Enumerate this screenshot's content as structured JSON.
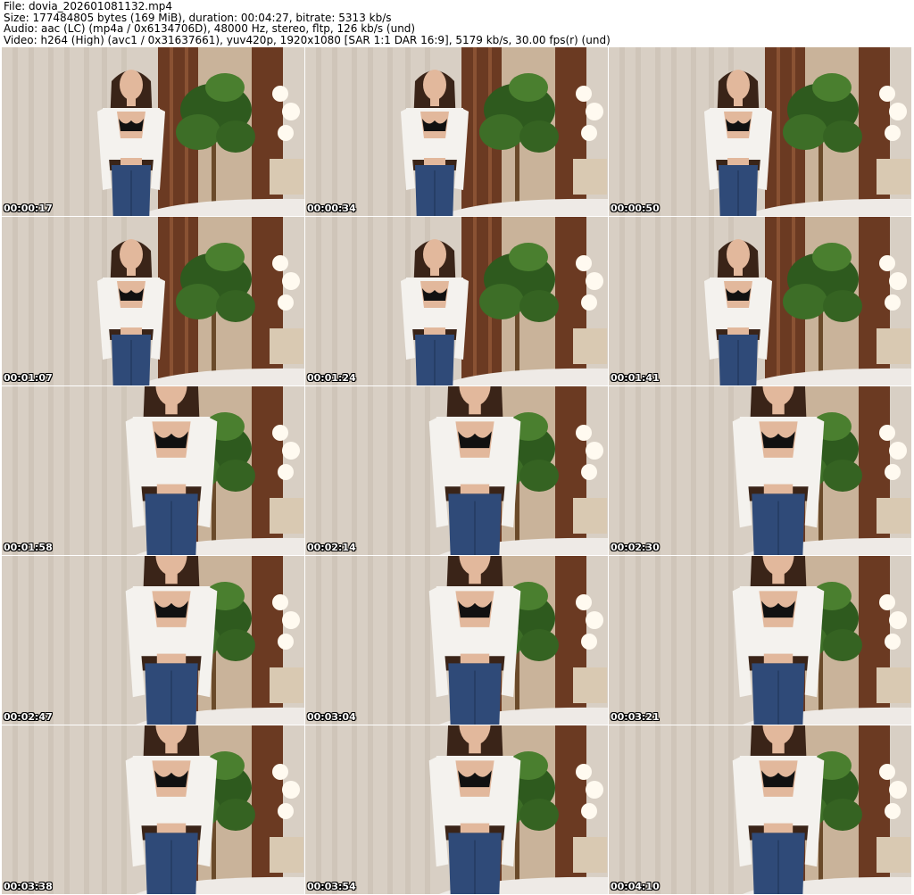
{
  "header": {
    "file_line": "File: dovia_202601081132.mp4",
    "size_line": "Size: 177484805 bytes (169 MiB), duration: 00:04:27, bitrate: 5313 kb/s",
    "audio_line": "Audio: aac (LC) (mp4a / 0x6134706D), 48000 Hz, stereo, fltp, 126 kb/s (und)",
    "video_line": "Video: h264 (High) (avc1 / 0x31637661), yuv420p, 1920x1080 [SAR 1:1 DAR 16:9], 5179 kb/s, 30.00 fps(r) (und)"
  },
  "thumbnails": [
    {
      "timestamp": "00:00:17",
      "zoom": 0,
      "offset": 0
    },
    {
      "timestamp": "00:00:34",
      "zoom": 0,
      "offset": 0
    },
    {
      "timestamp": "00:00:50",
      "zoom": 0,
      "offset": 0
    },
    {
      "timestamp": "00:01:07",
      "zoom": 0,
      "offset": 0
    },
    {
      "timestamp": "00:01:24",
      "zoom": 0,
      "offset": 0
    },
    {
      "timestamp": "00:01:41",
      "zoom": 0,
      "offset": 0
    },
    {
      "timestamp": "00:01:58",
      "zoom": 1,
      "offset": 0
    },
    {
      "timestamp": "00:02:14",
      "zoom": 1,
      "offset": 0
    },
    {
      "timestamp": "00:02:30",
      "zoom": 1,
      "offset": 0
    },
    {
      "timestamp": "00:02:47",
      "zoom": 1,
      "offset": 0
    },
    {
      "timestamp": "00:03:04",
      "zoom": 1,
      "offset": 0
    },
    {
      "timestamp": "00:03:21",
      "zoom": 1,
      "offset": 0
    },
    {
      "timestamp": "00:03:38",
      "zoom": 1,
      "offset": 0
    },
    {
      "timestamp": "00:03:54",
      "zoom": 1,
      "offset": 0
    },
    {
      "timestamp": "00:04:10",
      "zoom": 1,
      "offset": 0
    }
  ],
  "colors": {
    "curtain": "#d8cfc4",
    "wall": "#c9b39a",
    "wood_panel": "#6b3a22",
    "plant": "#2e5a1e",
    "shirt": "#f4f2ee",
    "jeans": "#2f4a78",
    "hair": "#3a2418",
    "skin": "#e2b89c",
    "bra": "#111111",
    "lamp": "#fffaf0",
    "bed": "#eeeae6"
  }
}
